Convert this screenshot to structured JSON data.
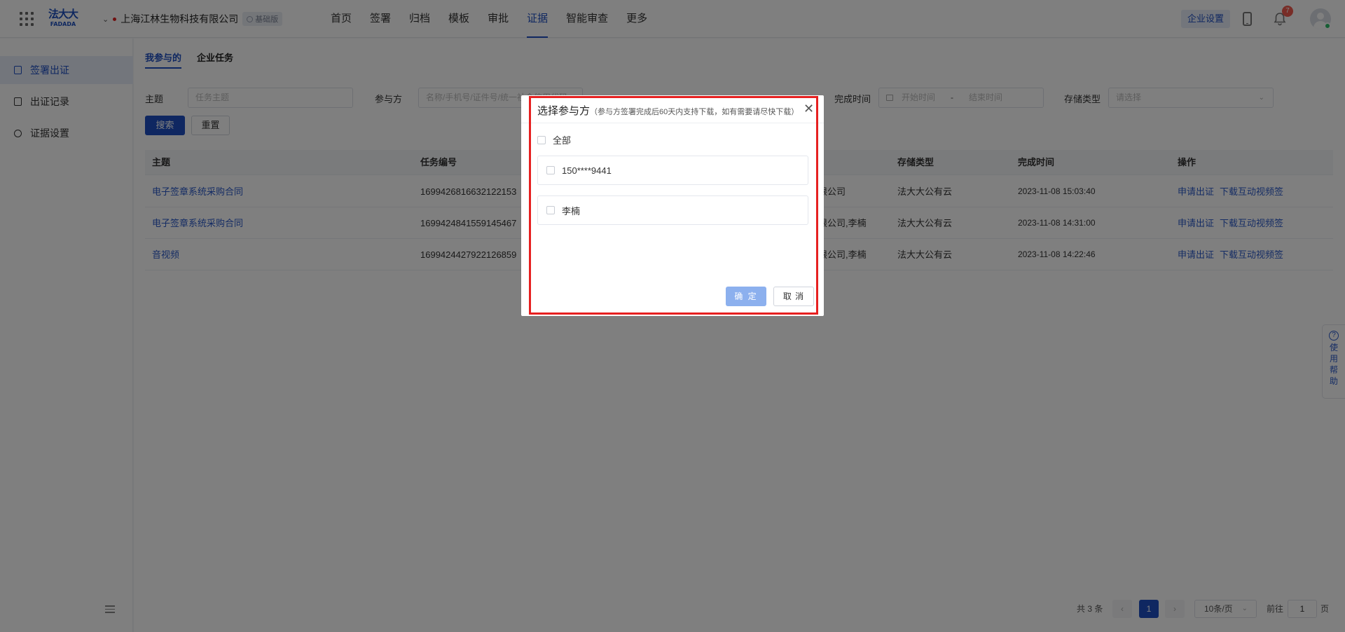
{
  "header": {
    "logo_top": "法大大",
    "logo_bottom": "FADADA",
    "company_name": "上海江林生物科技有限公司",
    "edition": "基础版",
    "nav": [
      "首页",
      "签署",
      "归档",
      "模板",
      "审批",
      "证据",
      "智能审查",
      "更多"
    ],
    "active_nav": "证据",
    "enterprise_settings": "企业设置",
    "notification_count": "7",
    "accent_color": "#1e4fc2"
  },
  "sidebar": {
    "items": [
      {
        "label": "签署出证",
        "icon": "document-icon",
        "active": true
      },
      {
        "label": "出证记录",
        "icon": "record-icon",
        "active": false
      },
      {
        "label": "证据设置",
        "icon": "gear-icon",
        "active": false
      }
    ]
  },
  "tabs": [
    "我参与的",
    "企业任务"
  ],
  "filters": {
    "subject_label": "主题",
    "subject_placeholder": "任务主题",
    "participant_label": "参与方",
    "participant_placeholder": "名称/手机号/证件号/统一社会信用代码",
    "complete_time_label": "完成时间",
    "start_placeholder": "开始时间",
    "range_sep": "-",
    "end_placeholder": "结束时间",
    "storage_label": "存储类型",
    "storage_placeholder": "请选择",
    "search_btn": "搜索",
    "reset_btn": "重置"
  },
  "table": {
    "headers": [
      "主题",
      "任务编号",
      "存储类型",
      "完成时间",
      "操作"
    ],
    "rows": [
      {
        "subject": "电子签章系统采购合同",
        "task_no": "1699426816632122153",
        "participants": "限公司",
        "storage": "法大大公有云",
        "time": "2023-11-08 15:03:40",
        "action1": "申请出证",
        "action2": "下载互动视频签"
      },
      {
        "subject": "电子签章系统采购合同",
        "task_no": "1699424841559145467",
        "participants": "限公司,李楠",
        "storage": "法大大公有云",
        "time": "2023-11-08 14:31:00",
        "action1": "申请出证",
        "action2": "下载互动视频签"
      },
      {
        "subject": "音视频",
        "task_no": "1699424427922126859",
        "participants": "限公司,李楠",
        "storage": "法大大公有云",
        "time": "2023-11-08 14:22:46",
        "action1": "申请出证",
        "action2": "下载互动视频签"
      }
    ]
  },
  "pagination": {
    "total": "共 3 条",
    "current": "1",
    "page_size": "10条/页",
    "goto_label": "前往",
    "goto_value": "1",
    "page_suffix": "页"
  },
  "help": {
    "icon": "?",
    "label": [
      "使",
      "用",
      "帮",
      "助"
    ]
  },
  "dialog": {
    "title": "选择参与方",
    "subtitle": "（参与方签署完成后60天内支持下载，如有需要请尽快下载）",
    "select_all": "全部",
    "options": [
      "150****9441",
      "李楠"
    ],
    "confirm": "确 定",
    "cancel": "取 消",
    "highlight_color": "#e62020"
  }
}
